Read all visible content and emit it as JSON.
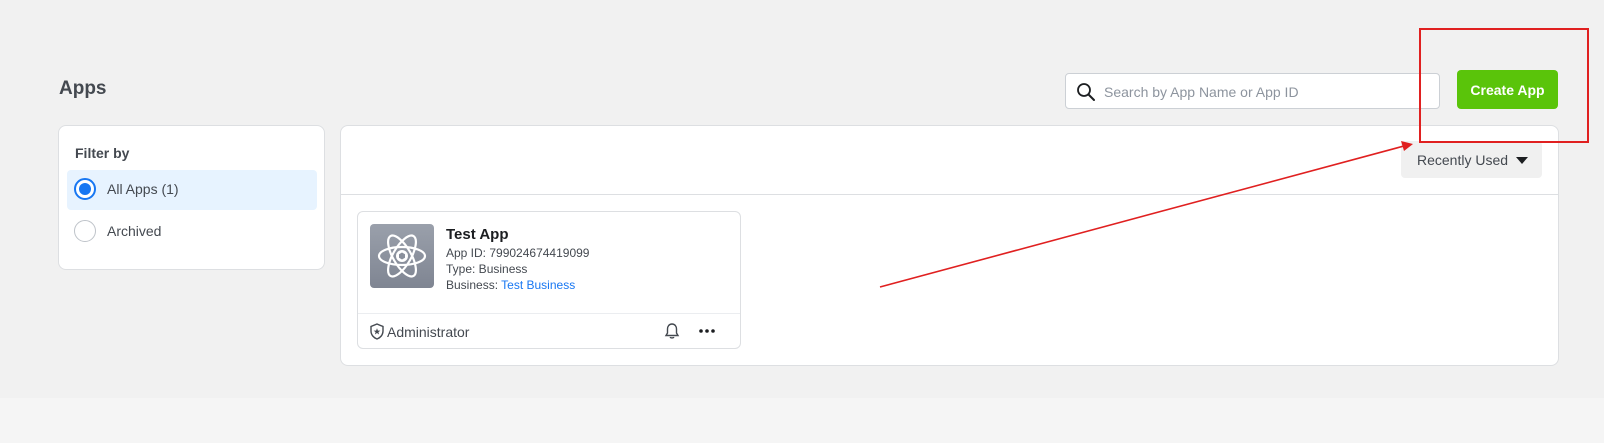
{
  "page": {
    "title": "Apps"
  },
  "search": {
    "placeholder": "Search by App Name or App ID",
    "icon": "search-icon"
  },
  "create_app": {
    "label": "Create App",
    "color": "#5ac40a"
  },
  "filter": {
    "title": "Filter by",
    "options": [
      {
        "label": "All Apps (1)",
        "selected": true
      },
      {
        "label": "Archived",
        "selected": false
      }
    ]
  },
  "sort": {
    "label": "Recently Used",
    "icon": "caret-down-icon"
  },
  "apps": [
    {
      "name": "Test App",
      "app_id_line": "App ID: 799024674419099",
      "type_line": "Type: Business",
      "business_prefix": "Business: ",
      "business_name": "Test Business",
      "role": "Administrator",
      "icons": [
        "atom-app-icon",
        "shield-icon",
        "bell-icon",
        "more-icon"
      ]
    }
  ],
  "annotation": {
    "color": "#e02020",
    "elements": [
      "highlight-box",
      "pointer-arrow"
    ]
  },
  "colors": {
    "background": "#f1f1f1",
    "link": "#1877f2",
    "selected_bg": "#e7f3ff"
  }
}
